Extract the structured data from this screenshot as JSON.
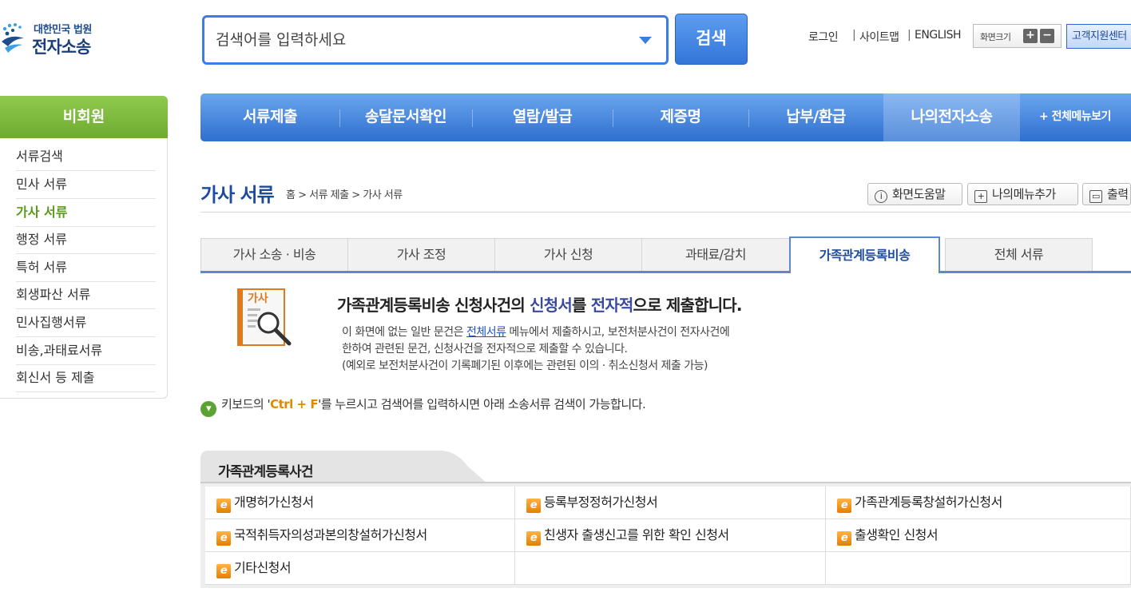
{
  "logo": {
    "small": "대한민국 법원",
    "big": "전자소송"
  },
  "search": {
    "placeholder": "검색어를 입력하세요",
    "button": "검색"
  },
  "util": {
    "login": "로그인",
    "sep": "|",
    "sitemap": "사이트맵",
    "english": "ENGLISH",
    "zoom_label": "화면크기",
    "zoom_plus": "+",
    "zoom_minus": "−",
    "customer": "고객지원센터"
  },
  "sidebar": {
    "header": "비회원",
    "items": [
      {
        "label": "서류검색"
      },
      {
        "label": "민사 서류"
      },
      {
        "label": "가사 서류"
      },
      {
        "label": "행정 서류"
      },
      {
        "label": "특허 서류"
      },
      {
        "label": "회생파산 서류"
      },
      {
        "label": "민사집행서류"
      },
      {
        "label": "비송,과태료서류"
      },
      {
        "label": "회신서 등 제출"
      }
    ]
  },
  "gnb": {
    "items": [
      {
        "label": "서류제출"
      },
      {
        "label": "송달문서확인"
      },
      {
        "label": "열람/발급"
      },
      {
        "label": "제증명"
      },
      {
        "label": "납부/환급"
      },
      {
        "label": "나의전자소송"
      }
    ],
    "all_menu": "+ 전체메뉴보기"
  },
  "page": {
    "title": "가사 서류",
    "breadcrumb": "홈 > 서류 제출 > 가사 서류",
    "help": "화면도움말",
    "add_menu": "나의메뉴추가",
    "print": "출력"
  },
  "tabs": [
    {
      "label": "가사 소송 · 비송"
    },
    {
      "label": "가사 조정"
    },
    {
      "label": "가사 신청"
    },
    {
      "label": "과태료/감치"
    },
    {
      "label": "가족관계등록비송"
    },
    {
      "label": "전체 서류"
    }
  ],
  "info": {
    "icon_text": "가사",
    "head_1": "가족관계등록비송 신청사건의 ",
    "head_hl1": "신청서",
    "head_2": "를 ",
    "head_hl2": "전자적",
    "head_3": "으로 제출합니다.",
    "line1_a": "이 화면에 없는 일반 문건은 ",
    "line1_link": "전체서류",
    "line1_b": " 메뉴에서 제출하시고, 보전처분사건이 전자사건에",
    "line2": "한하여 관련된 문건, 신청사건을 전자적으로 제출할 수 있습니다.",
    "line3": "(예외로 보전처분사건이 기록폐기된 이후에는 관련된 이의 · 취소신청서 제출 가능)"
  },
  "hint": {
    "pre": "키보드의 '",
    "key": "Ctrl + F",
    "post": "'를 누르시고 검색어를 입력하시면 아래 소송서류 검색이 가능합니다."
  },
  "documents": {
    "section_title": "가족관계등록사건",
    "icon_glyph": "e",
    "rows": [
      [
        "개명허가신청서",
        "등록부정정허가신청서",
        "가족관계등록창설허가신청서"
      ],
      [
        "국적취득자의성과본의창설허가신청서",
        "친생자 출생신고를 위한 확인 신청서",
        "출생확인 신청서"
      ],
      [
        "기타신청서",
        "",
        ""
      ]
    ]
  },
  "colors": {
    "brand_blue": "#2f6fcf",
    "sidebar_green": "#6eab2f",
    "active_green": "#5a9a1c",
    "tab_blue": "#5d88cf"
  }
}
